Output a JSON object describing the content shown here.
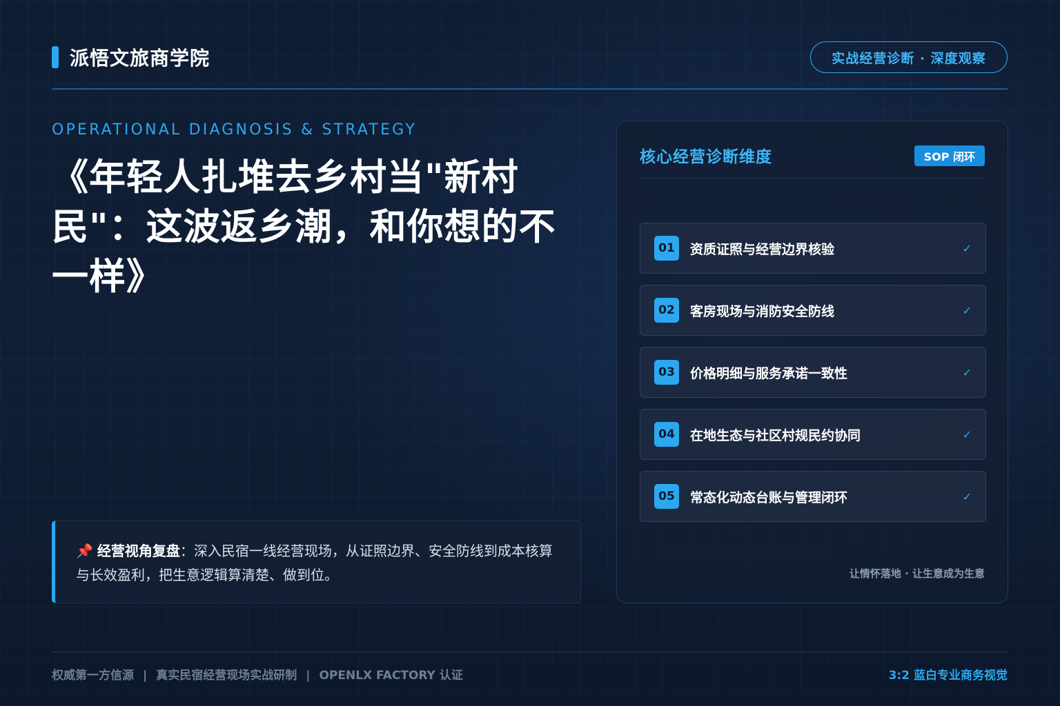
{
  "header": {
    "brand_name": "派悟文旅商学院",
    "tag": "实战经营诊断 · 深度观察"
  },
  "hero": {
    "subtitle_en": "OPERATIONAL DIAGNOSIS & STRATEGY",
    "title": "《年轻人扎堆去乡村当\"新村民\"：这波返乡潮，和你想的不一样》"
  },
  "quote": {
    "pin_icon": "📌",
    "lead": "经营视角复盘",
    "text": "：深入民宿一线经营现场，从证照边界、安全防线到成本核算与长效盈利，把生意逻辑算清楚、做到位。"
  },
  "panel": {
    "title": "核心经营诊断维度",
    "badge": "SOP 闭环",
    "items": [
      {
        "num": "01",
        "label": "资质证照与经营边界核验",
        "check": "✓"
      },
      {
        "num": "02",
        "label": "客房现场与消防安全防线",
        "check": "✓"
      },
      {
        "num": "03",
        "label": "价格明细与服务承诺一致性",
        "check": "✓"
      },
      {
        "num": "04",
        "label": "在地生态与社区村规民约协同",
        "check": "✓"
      },
      {
        "num": "05",
        "label": "常态化动态台账与管理闭环",
        "check": "✓"
      }
    ],
    "footer": "让情怀落地 · 让生意成为生意"
  },
  "footer": {
    "left_items": [
      "权威第一方信源",
      "真实民宿经营现场实战研制",
      "OPENLX FACTORY 认证"
    ],
    "separator": "|",
    "right": "3:2 蓝白专业商务视觉"
  },
  "colors": {
    "accent": "#2ba8f0",
    "background": "#0d1a2e",
    "text": "#ffffff"
  }
}
